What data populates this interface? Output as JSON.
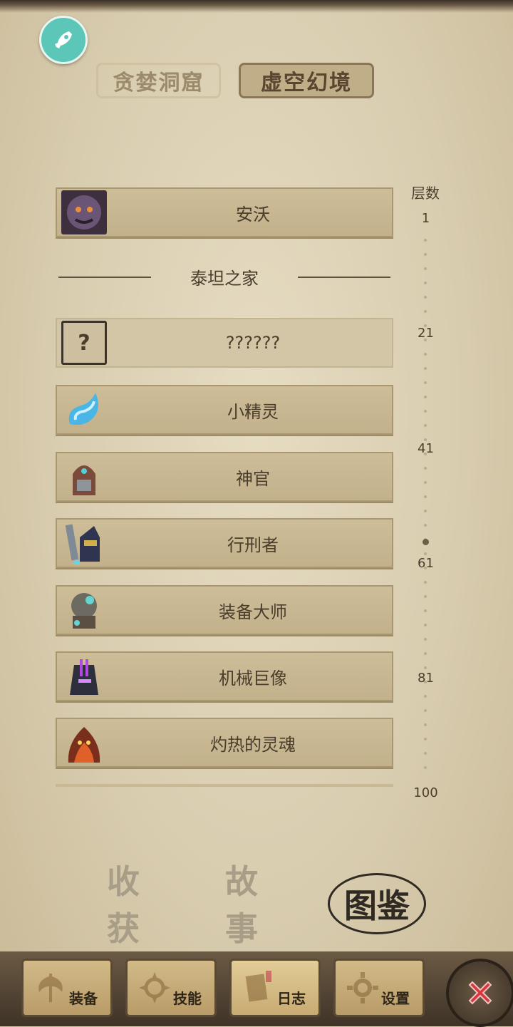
{
  "header": {
    "tabs": [
      {
        "label": "贪婪洞窟",
        "selected": false
      },
      {
        "label": "虚空幻境",
        "selected": true
      }
    ]
  },
  "levels": {
    "header": "层数",
    "ticks": [
      "1",
      "21",
      "41",
      "61",
      "81",
      "100"
    ]
  },
  "entries": [
    {
      "name": "安沃",
      "icon": "demon-face-portrait"
    },
    {
      "name": "??????",
      "icon": "unknown-question-portrait"
    },
    {
      "name": "小精灵",
      "icon": "blue-wisp-portrait"
    },
    {
      "name": "神官",
      "icon": "priest-portrait"
    },
    {
      "name": "行刑者",
      "icon": "executioner-portrait"
    },
    {
      "name": "装备大师",
      "icon": "equipment-master-portrait"
    },
    {
      "name": "机械巨像",
      "icon": "mech-colossus-portrait"
    },
    {
      "name": "灼热的灵魂",
      "icon": "burning-soul-portrait"
    }
  ],
  "section": {
    "title": "泰坦之家"
  },
  "modes": [
    {
      "label": "收获",
      "selected": false
    },
    {
      "label": "故事",
      "selected": false
    },
    {
      "label": "图鉴",
      "selected": true
    }
  ],
  "nav": [
    {
      "label": "装备",
      "icon": "axe-icon"
    },
    {
      "label": "技能",
      "icon": "skill-burst-icon"
    },
    {
      "label": "日志",
      "icon": "journal-book-icon",
      "active": true
    },
    {
      "label": "设置",
      "icon": "gear-icon"
    }
  ],
  "colors": {
    "parchment": "#d9cdb0",
    "accent_teal": "#5cc6b9",
    "close_red": "#d9363e"
  }
}
